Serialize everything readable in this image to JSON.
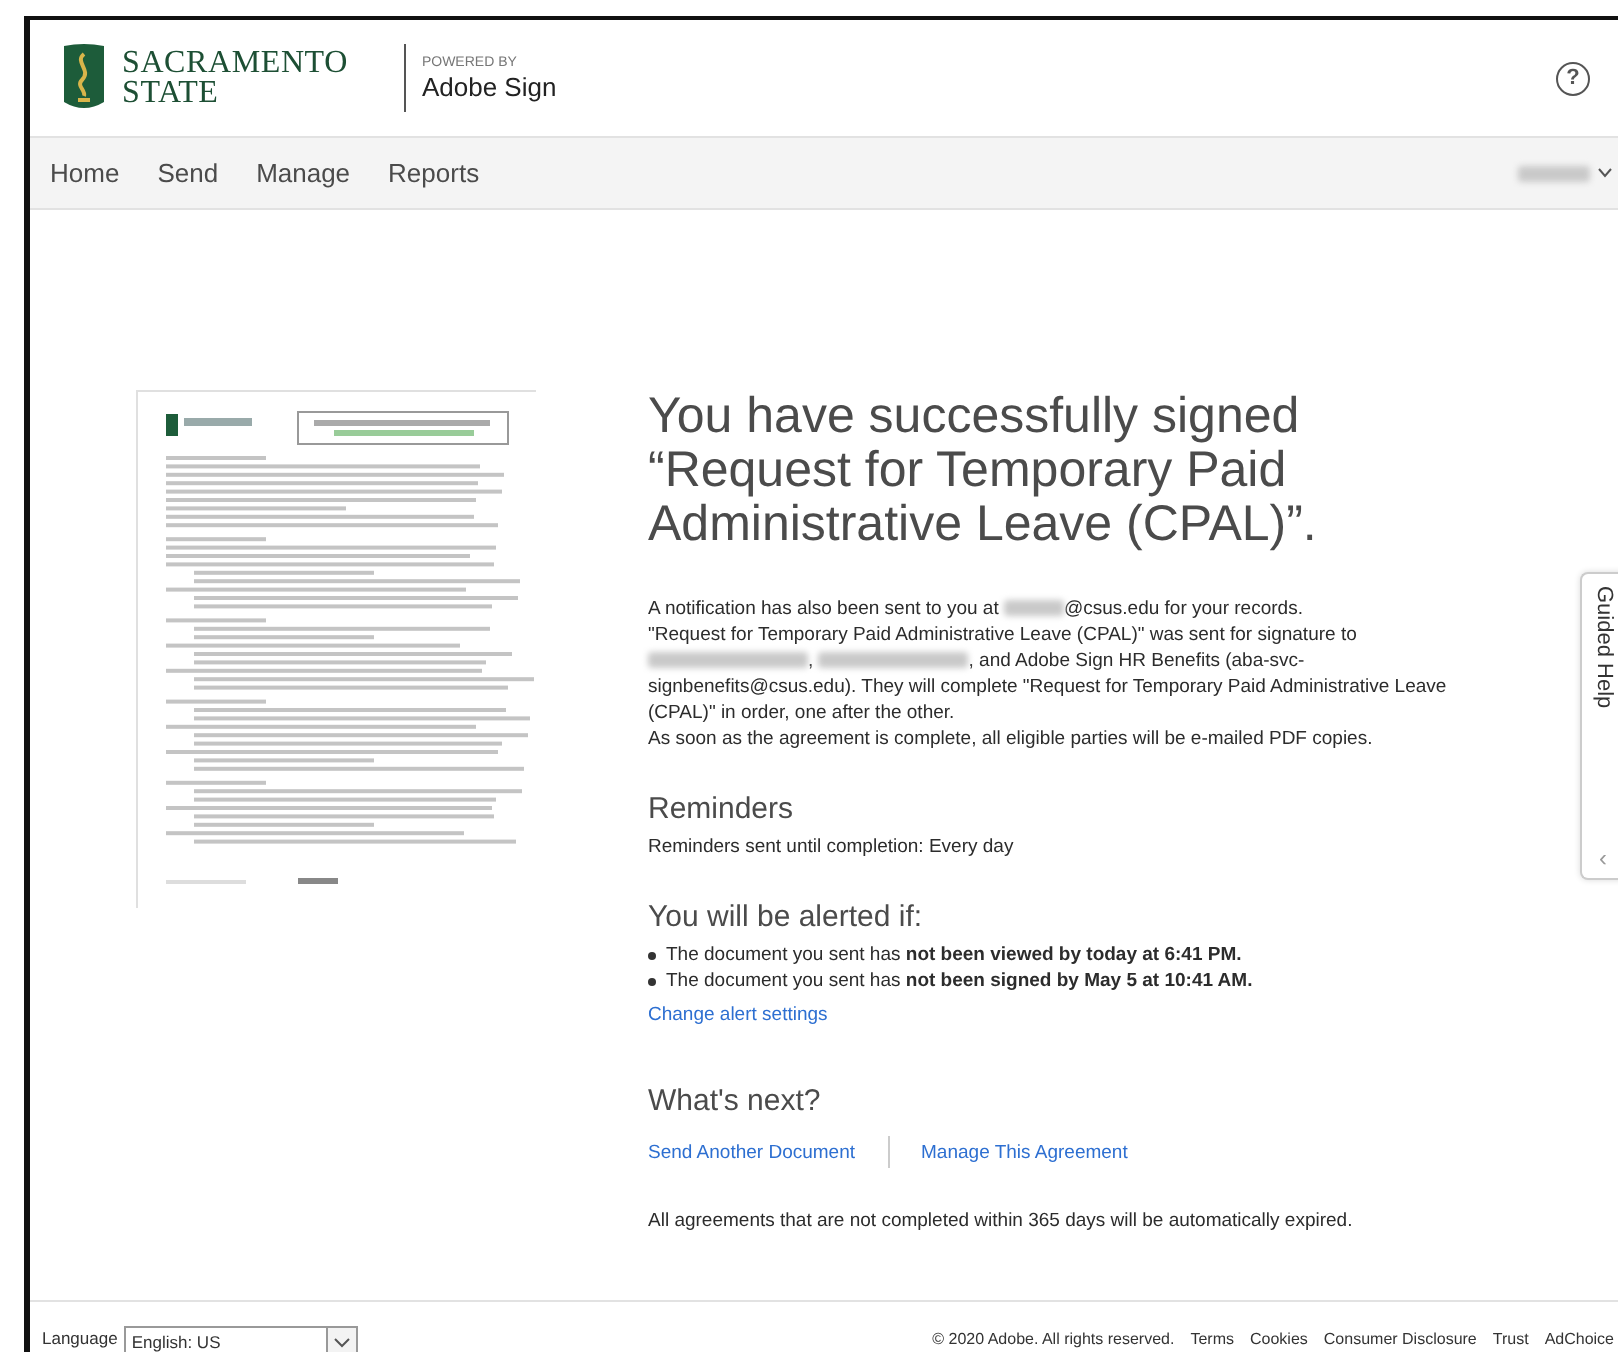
{
  "header": {
    "logo_line1": "SACRAMENTO",
    "logo_line2": "STATE",
    "powered_by": "POWERED BY",
    "product": "Adobe Sign",
    "help": "?"
  },
  "nav": {
    "items": [
      "Home",
      "Send",
      "Manage",
      "Reports"
    ]
  },
  "confirmation": {
    "title": "You have successfully signed “Request for Temporary Paid Administrative Leave (CPAL)”.",
    "notification": [
      "A notification has also been sent to you at",
      "@csus.edu for your records."
    ],
    "recipients": [
      "\"Request for Temporary Paid Administrative Leave (CPAL)\" was sent for signature to",
      ", ",
      ", and Adobe Sign HR Benefits (aba-svc-signbenefits@csus.edu). They will complete \"Request for Temporary Paid Administrative Leave (CPAL)\" in order, one after the other."
    ],
    "completion": "As soon as the agreement is complete, all eligible parties will be e-mailed PDF copies."
  },
  "reminders": {
    "heading": "Reminders",
    "text": "Reminders sent until completion: Every day"
  },
  "alerts": {
    "heading": "You will be alerted if:",
    "items": [
      "The document you sent has **not been viewed by today at 6:41 PM.**",
      "The document you sent has **not been signed by May 5 at 10:41 AM.**"
    ],
    "link": "Change alert settings"
  },
  "next": {
    "heading": "What's next?",
    "links": [
      "Send Another Document",
      "Manage This Agreement"
    ],
    "note": "All agreements that are not completed within 365 days will be automatically expired."
  },
  "guided_help": {
    "label": "Guided Help",
    "collapse": "‹"
  },
  "footer": {
    "language_label": "Language",
    "language_value": "English: US",
    "copyright": "© 2020 Adobe. All rights reserved.",
    "links": [
      "Terms",
      "Cookies",
      "Consumer Disclosure",
      "Trust",
      "AdChoice"
    ]
  }
}
